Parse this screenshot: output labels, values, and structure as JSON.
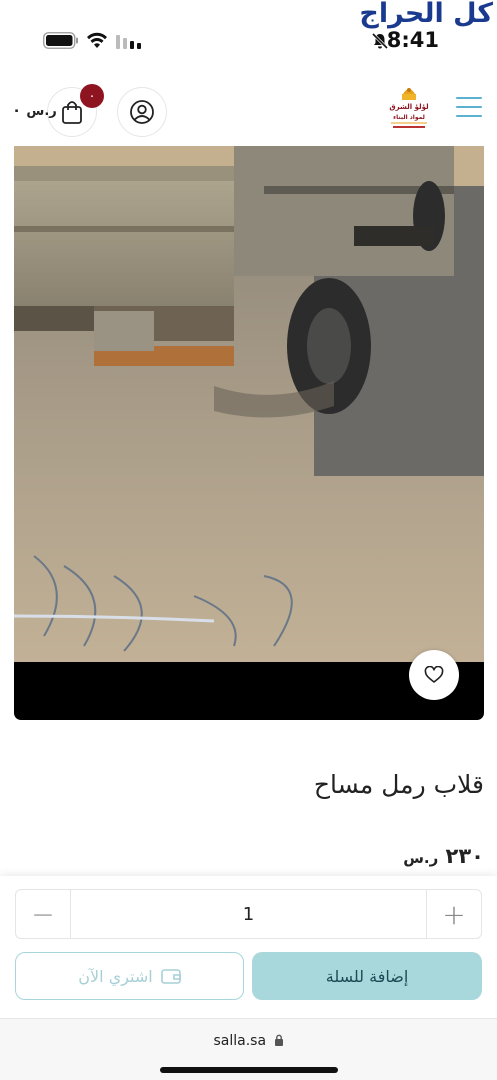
{
  "status_bar": {
    "brand_watermark": "كل الحراج",
    "time": "8:41"
  },
  "header": {
    "logo_text": "لؤلؤ الشرق لمواد البناء",
    "cart_badge": "٠",
    "cart_total": "٠",
    "currency_symbol": "ر.س"
  },
  "product": {
    "title": "قلاب رمل مساح",
    "price": "٢٣٠"
  },
  "purchase": {
    "quantity": "1",
    "minus_label": "−",
    "plus_label": "+",
    "buy_now_label": "اشتري الآن",
    "add_to_cart_label": "إضافة للسلة"
  },
  "browser": {
    "url": "salla.sa"
  },
  "colors": {
    "accent": "#a9d8dc",
    "badge": "#8e1520",
    "brand": "#1a3a8f"
  }
}
